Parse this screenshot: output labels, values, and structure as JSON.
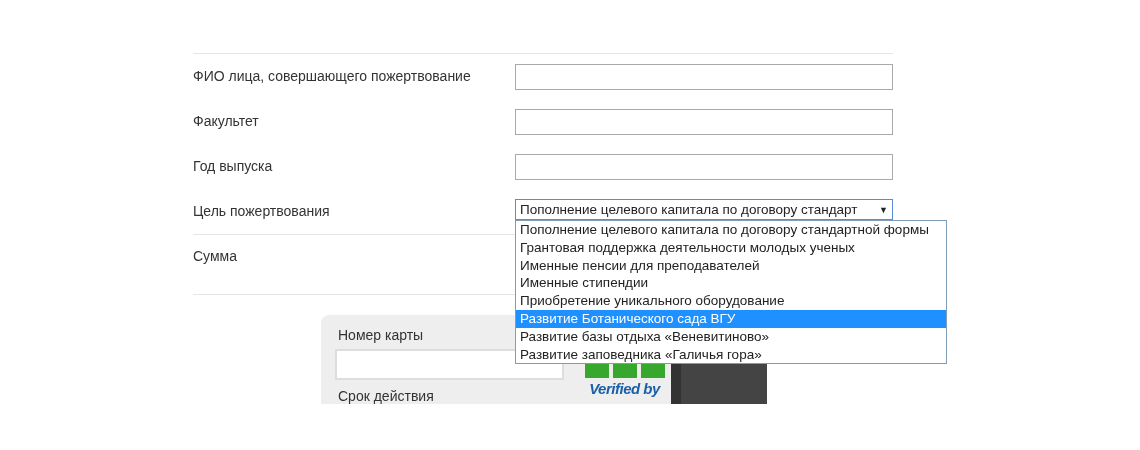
{
  "fields": [
    {
      "label": "ФИО лица, совершающего пожертвование",
      "kind": "text"
    },
    {
      "label": "Факультет",
      "kind": "text"
    },
    {
      "label": "Год выпуска",
      "kind": "text"
    },
    {
      "label": "Цель пожертвования",
      "kind": "select",
      "value": "Пополнение целевого капитала по договору стандарт",
      "arrow": "▼",
      "expanded": true
    }
  ],
  "sum": {
    "label": "Сумма"
  },
  "options": [
    {
      "label": "Пополнение целевого капитала по договору стандартной формы",
      "selected": false
    },
    {
      "label": "Грантовая поддержка деятельности молодых ученых",
      "selected": false
    },
    {
      "label": "Именные пенсии для преподавателей",
      "selected": false
    },
    {
      "label": "Именные стипендии",
      "selected": false
    },
    {
      "label": "Приобретение уникального оборудование",
      "selected": false
    },
    {
      "label": "Развитие Ботанического сада ВГУ",
      "selected": true
    },
    {
      "label": "Развитие базы отдыха «Веневитиново»",
      "selected": false
    },
    {
      "label": "Развитие заповедника «Галичья гора»",
      "selected": false
    }
  ],
  "card": {
    "number_label": "Номер карты",
    "expiry_label": "Срок действия",
    "verified": "Verified by"
  }
}
